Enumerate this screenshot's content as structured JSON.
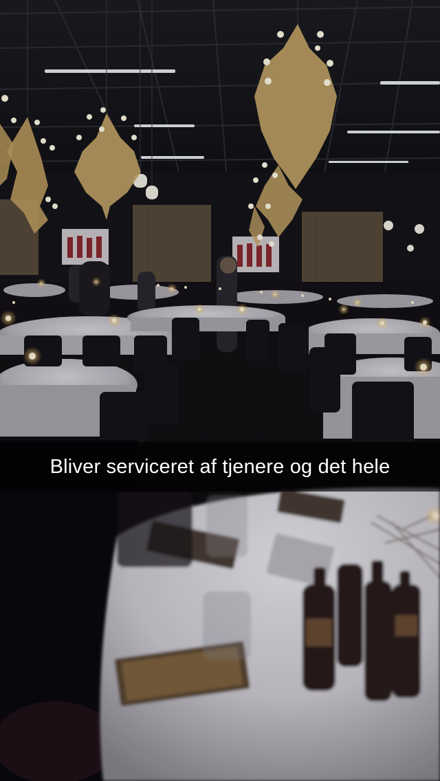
{
  "snap": {
    "caption": "Bliver serviceret af tjenere og det hele"
  },
  "palette": {
    "ceiling": "#16171c",
    "wall": "#1a1716",
    "tablecloth": "#d8d6dc",
    "candle": "#fff2cc",
    "chandelier": "#c9a86a",
    "caption_bg": "#000000",
    "caption_text": "#ffffff"
  }
}
